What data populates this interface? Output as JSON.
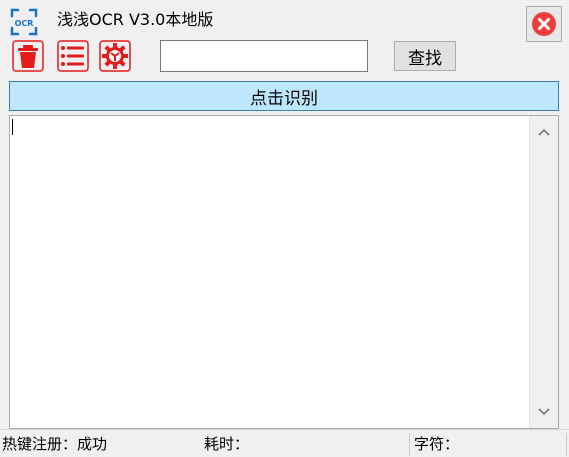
{
  "window": {
    "title": "浅浅OCR V3.0本地版",
    "logo_text": "OCR"
  },
  "toolbar": {
    "search": {
      "value": "",
      "placeholder": ""
    },
    "find_label": "查找",
    "icons": [
      "trash-icon",
      "list-icon",
      "gear-icon"
    ]
  },
  "main": {
    "recognize_label": "点击识别",
    "result_text": ""
  },
  "status": {
    "hotkey": "热键注册：成功",
    "time_label": "耗时：",
    "chars_label": "字符："
  },
  "colors": {
    "accent_red": "#e31b1b",
    "close_red": "#e8413a",
    "logo_blue": "#1a73c8",
    "recognize_bg": "#bee6fd",
    "recognize_border": "#3c7fb1"
  }
}
